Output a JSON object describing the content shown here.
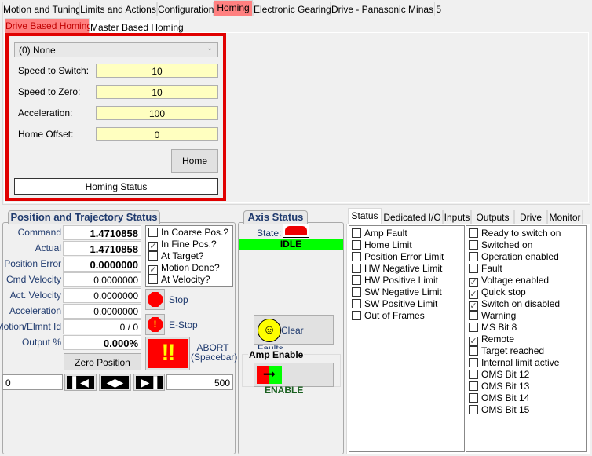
{
  "main_tabs": [
    "Motion and Tuning",
    "Limits and Actions",
    "Configuration",
    "Homing",
    "Electronic Gearing",
    "Drive - Panasonic Minas 5"
  ],
  "sub_tabs": [
    "Drive Based Homing",
    "Master Based Homing"
  ],
  "homing": {
    "method": "(0) None",
    "fields": [
      {
        "label": "Speed to Switch:",
        "value": "10"
      },
      {
        "label": "Speed to Zero:",
        "value": "10"
      },
      {
        "label": "Acceleration:",
        "value": "100"
      },
      {
        "label": "Home Offset:",
        "value": "0"
      }
    ],
    "home_button": "Home",
    "status": "Homing Status"
  },
  "position": {
    "title": "Position and Trajectory Status",
    "rows": [
      {
        "label": "Command",
        "value": "1.4710858",
        "bold": true
      },
      {
        "label": "Actual",
        "value": "1.4710858",
        "bold": true
      },
      {
        "label": "Position Error",
        "value": "0.0000000",
        "bold": true
      },
      {
        "label": "Cmd Velocity",
        "value": "0.0000000"
      },
      {
        "label": "Act. Velocity",
        "value": "0.0000000"
      },
      {
        "label": "Acceleration",
        "value": "0.0000000"
      },
      {
        "label": "Motion/Elmnt Id",
        "value": "0 / 0"
      },
      {
        "label": "Output %",
        "value": "0.000%",
        "bold": true
      }
    ],
    "checks": [
      {
        "label": "In Coarse Pos.?",
        "checked": false
      },
      {
        "label": "In Fine Pos.?",
        "checked": true
      },
      {
        "label": "At Target?",
        "checked": false
      },
      {
        "label": "Motion Done?",
        "checked": true
      },
      {
        "label": "At Velocity?",
        "checked": false
      }
    ],
    "stop": "Stop",
    "estop": "E-Stop",
    "abort": "ABORT",
    "abort_key": "(Spacebar)",
    "zero": "Zero Position",
    "jog_min": "0",
    "jog_max": "500"
  },
  "axis": {
    "title": "Axis Status",
    "state_label": "State:",
    "state": "IDLE",
    "state_color": "#00ff00",
    "clear_faults": "Clear Faults",
    "amp_enable": "Amp Enable",
    "enable": "ENABLE"
  },
  "status_tabs": [
    "Status",
    "Dedicated I/O",
    "Inputs",
    "Outputs",
    "Drive",
    "Monitor"
  ],
  "status_left": [
    {
      "label": "Amp Fault",
      "checked": false
    },
    {
      "label": "Home Limit",
      "checked": false
    },
    {
      "label": "Position Error Limit",
      "checked": false
    },
    {
      "label": "HW Negative Limit",
      "checked": false
    },
    {
      "label": "HW Positive Limit",
      "checked": false
    },
    {
      "label": "SW Negative Limit",
      "checked": false
    },
    {
      "label": "SW Positive Limit",
      "checked": false
    },
    {
      "label": "Out of Frames",
      "checked": false
    }
  ],
  "status_right": [
    {
      "label": "Ready to switch on",
      "checked": false
    },
    {
      "label": "Switched on",
      "checked": false
    },
    {
      "label": "Operation enabled",
      "checked": false
    },
    {
      "label": "Fault",
      "checked": false
    },
    {
      "label": "Voltage enabled",
      "checked": true
    },
    {
      "label": "Quick stop",
      "checked": true
    },
    {
      "label": "Switch on disabled",
      "checked": true
    },
    {
      "label": "Warning",
      "checked": false
    },
    {
      "label": "MS Bit 8",
      "checked": false
    },
    {
      "label": "Remote",
      "checked": true
    },
    {
      "label": "Target reached",
      "checked": false
    },
    {
      "label": "Internal limit active",
      "checked": false
    },
    {
      "label": "OMS Bit 12",
      "checked": false
    },
    {
      "label": "OMS Bit 13",
      "checked": false
    },
    {
      "label": "OMS Bit 14",
      "checked": false
    },
    {
      "label": "OMS Bit 15",
      "checked": false
    }
  ]
}
